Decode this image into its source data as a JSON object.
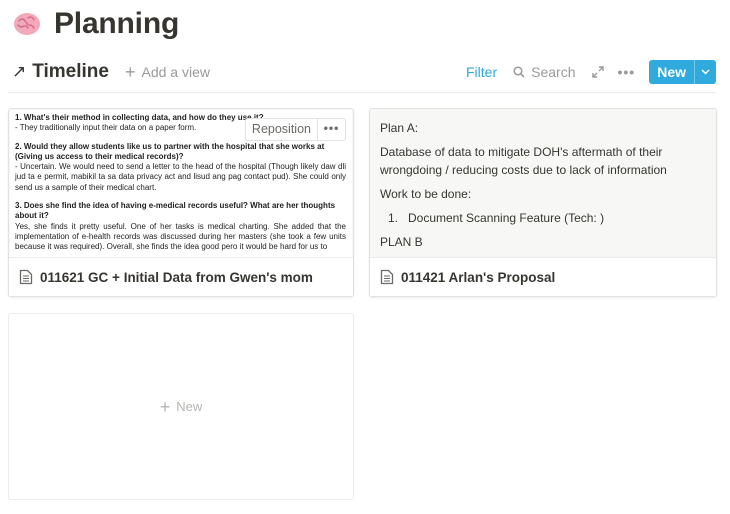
{
  "page": {
    "title": "Planning",
    "emoji_icon": "brain-icon"
  },
  "toolbar": {
    "view_name": "Timeline",
    "view_icon": "arrow-up-right-icon",
    "add_view_label": "Add a view",
    "filter_label": "Filter",
    "search_label": "Search",
    "new_label": "New"
  },
  "colors": {
    "accent": "#2eaadc",
    "text": "#37352f",
    "muted": "#9b9a97"
  },
  "cards": [
    {
      "title": "011621 GC + Initial Data from Gwen's mom",
      "reposition_label": "Reposition",
      "preview": [
        {
          "q": "1. What's their method in collecting data, and how do they use it?",
          "a": "- They traditionally input their data on a paper form."
        },
        {
          "q": "2. Would they allow students like us to partner with the hospital that she works at (Giving us access to their medical records)?",
          "a": "- Uncertain. We would need to send a letter to the head of the hospital (Though likely daw dli jud ta e permit, mabikil ta sa data privacy act and lisud ang pag contact pud). She could only send us a sample of their medical chart."
        },
        {
          "q": "3. Does she find the idea of having e-medical records useful? What are her thoughts about it?",
          "a": "Yes, she finds it pretty useful. One of her tasks is medical charting. She added that the implementation of e-health records was discussed during her masters (she took a few units because it was required). Overall, she finds the idea good pero it would be hard for us to"
        }
      ]
    },
    {
      "title": "011421 Arlan's Proposal",
      "preview": {
        "plan_a": "Plan A:",
        "description": "Database of data to mitigate DOH's aftermath of their wrongdoing / reducing costs due to lack of information",
        "work_label": "Work to be done:",
        "item_number": "1.",
        "item_text": "Document Scanning Feature (Tech: )",
        "plan_b": "PLAN B"
      }
    }
  ],
  "new_card_label": "New"
}
